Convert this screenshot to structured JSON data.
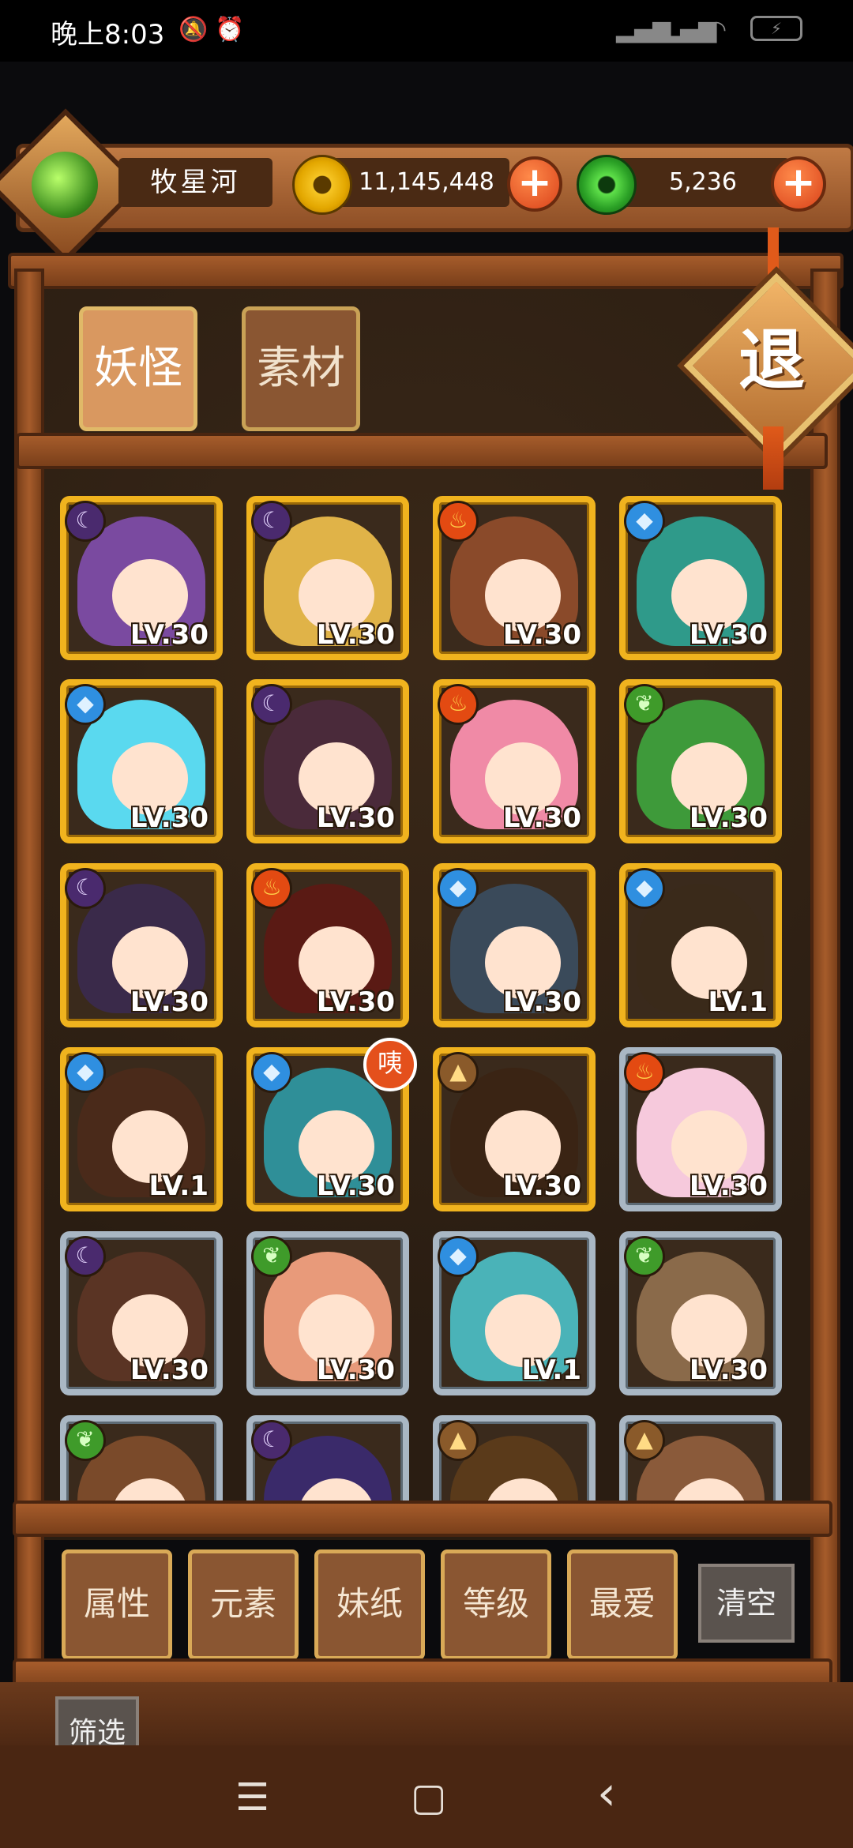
{
  "status_bar": {
    "time": "晚上8:03",
    "icons": [
      "mute-icon",
      "alarm-icon",
      "signal-icon",
      "signal-icon",
      "wifi-icon",
      "battery-icon"
    ]
  },
  "header": {
    "player_name": "牧星河",
    "coins": "11,145,448",
    "gems": "5,236"
  },
  "tabs": [
    {
      "label": "妖怪",
      "active": true
    },
    {
      "label": "素材",
      "active": false
    }
  ],
  "retreat_label": "退",
  "cards": [
    {
      "element": "moon",
      "level": "LV.30",
      "frame": "gold",
      "hair": "#7a4aa0"
    },
    {
      "element": "moon",
      "level": "LV.30",
      "frame": "gold",
      "hair": "#e0b348"
    },
    {
      "element": "fire",
      "level": "LV.30",
      "frame": "gold",
      "hair": "#8a4a2a"
    },
    {
      "element": "water",
      "level": "LV.30",
      "frame": "gold",
      "hair": "#2f9a8a"
    },
    {
      "element": "water",
      "level": "LV.30",
      "frame": "gold",
      "hair": "#5ad9ef"
    },
    {
      "element": "moon",
      "level": "LV.30",
      "frame": "gold",
      "hair": "#4a2a3a"
    },
    {
      "element": "fire",
      "level": "LV.30",
      "frame": "gold",
      "hair": "#f08aa6"
    },
    {
      "element": "leaf",
      "level": "LV.30",
      "frame": "gold",
      "hair": "#3e9a3a"
    },
    {
      "element": "moon",
      "level": "LV.30",
      "frame": "gold",
      "hair": "#3a2a4a"
    },
    {
      "element": "fire",
      "level": "LV.30",
      "frame": "gold",
      "hair": "#5a1a14"
    },
    {
      "element": "water",
      "level": "LV.30",
      "frame": "gold",
      "hair": "#3a4a5a"
    },
    {
      "element": "water",
      "level": "LV.1",
      "frame": "gold",
      "hair": "#3a2a1a"
    },
    {
      "element": "water",
      "level": "LV.1",
      "frame": "gold",
      "hair": "#4a2a1a"
    },
    {
      "element": "water",
      "level": "LV.30",
      "frame": "gold",
      "hair": "#2f8f98",
      "badge": "咦"
    },
    {
      "element": "earth",
      "level": "LV.30",
      "frame": "gold",
      "hair": "#3a2414"
    },
    {
      "element": "fire",
      "level": "LV.30",
      "frame": "silver",
      "hair": "#f6c9dc"
    },
    {
      "element": "moon",
      "level": "LV.30",
      "frame": "silver",
      "hair": "#5a3424"
    },
    {
      "element": "leaf",
      "level": "LV.30",
      "frame": "silver",
      "hair": "#e89a7a"
    },
    {
      "element": "water",
      "level": "LV.1",
      "frame": "silver",
      "hair": "#4ab3b8"
    },
    {
      "element": "leaf",
      "level": "LV.30",
      "frame": "silver",
      "hair": "#8a6a4a"
    },
    {
      "element": "leaf",
      "level": "",
      "frame": "silver",
      "hair": "#7a4a2a"
    },
    {
      "element": "moon",
      "level": "",
      "frame": "silver",
      "hair": "#3a2a6a"
    },
    {
      "element": "earth",
      "level": "",
      "frame": "silver",
      "hair": "#5a3a1a"
    },
    {
      "element": "earth",
      "level": "",
      "frame": "silver",
      "hair": "#8a5a3a"
    }
  ],
  "element_icons": {
    "moon": "☾",
    "fire": "♨",
    "water": "◆",
    "leaf": "❦",
    "earth": "▲"
  },
  "filter_buttons": [
    "属性",
    "元素",
    "妹纸",
    "等级",
    "最爱"
  ],
  "clear_label": "清空",
  "filter_label": "筛选",
  "nav": {
    "menu": "☰",
    "home": "▢",
    "back": "‹"
  }
}
